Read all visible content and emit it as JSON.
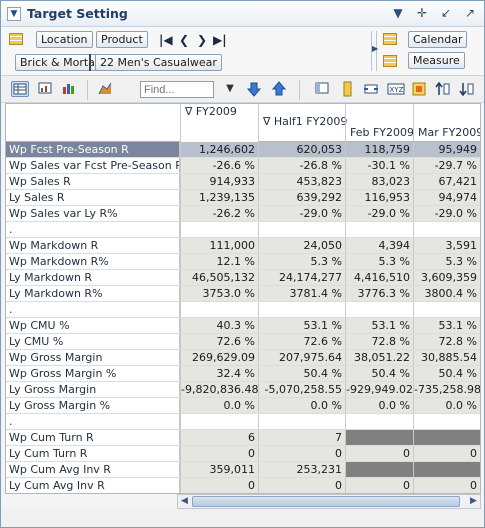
{
  "window": {
    "title": "Target Setting"
  },
  "title_icons": [
    "dropdown-arrow-icon",
    "move-icon",
    "minimize-icon",
    "expand-icon"
  ],
  "dimensions": {
    "location_label": "Location",
    "product_label": "Product",
    "calendar_label": "Calendar",
    "measure_label": "Measure",
    "location_value": "Brick & Mortar",
    "product_value": "22 Men's Casualwear"
  },
  "toolbar": {
    "find_placeholder": "Find..."
  },
  "columns": {
    "fy": "∇ FY2009",
    "half": "∇ Half1 FY2009",
    "feb": "Feb FY2009",
    "mar": "Mar FY2009"
  },
  "rows": [
    {
      "label": "Wp Fcst Pre-Season R",
      "v": [
        "1,246,602",
        "620,053",
        "118,759",
        "95,949"
      ],
      "selected": true
    },
    {
      "label": "Wp Sales var Fcst Pre-Season R%",
      "v": [
        "-26.6 %",
        "-26.8 %",
        "-30.1 %",
        "-29.7 %"
      ]
    },
    {
      "label": "Wp Sales R",
      "v": [
        "914,933",
        "453,823",
        "83,023",
        "67,421"
      ]
    },
    {
      "label": "Ly Sales R",
      "v": [
        "1,239,135",
        "639,292",
        "116,953",
        "94,974"
      ]
    },
    {
      "label": "Wp Sales var Ly R%",
      "v": [
        "-26.2 %",
        "-29.0 %",
        "-29.0 %",
        "-29.0 %"
      ]
    },
    {
      "label": ".",
      "v": [
        "",
        "",
        "",
        ""
      ],
      "blank": true
    },
    {
      "label": "Wp Markdown R",
      "v": [
        "111,000",
        "24,050",
        "4,394",
        "3,591"
      ]
    },
    {
      "label": "Wp Markdown R%",
      "v": [
        "12.1 %",
        "5.3 %",
        "5.3 %",
        "5.3 %"
      ]
    },
    {
      "label": "Ly Markdown R",
      "v": [
        "46,505,132",
        "24,174,277",
        "4,416,510",
        "3,609,359"
      ]
    },
    {
      "label": "Ly Markdown R%",
      "v": [
        "3753.0 %",
        "3781.4 %",
        "3776.3 %",
        "3800.4 %"
      ]
    },
    {
      "label": ".",
      "v": [
        "",
        "",
        "",
        ""
      ],
      "blank": true
    },
    {
      "label": "Wp CMU %",
      "v": [
        "40.3 %",
        "53.1 %",
        "53.1 %",
        "53.1 %"
      ]
    },
    {
      "label": "Ly CMU %",
      "v": [
        "72.6 %",
        "72.6 %",
        "72.8 %",
        "72.8 %"
      ]
    },
    {
      "label": "Wp Gross Margin",
      "v": [
        "269,629.09",
        "207,975.64",
        "38,051.22",
        "30,885.54"
      ]
    },
    {
      "label": "Wp Gross Margin %",
      "v": [
        "32.4 %",
        "50.4 %",
        "50.4 %",
        "50.4 %"
      ]
    },
    {
      "label": "Ly Gross Margin",
      "v": [
        "-9,820,836.48",
        "-5,070,258.55",
        "-929,949.02",
        "-735,258.98"
      ]
    },
    {
      "label": "Ly Gross Margin %",
      "v": [
        "0.0 %",
        "0.0 %",
        "0.0 %",
        "0.0 %"
      ]
    },
    {
      "label": ".",
      "v": [
        "",
        "",
        "",
        ""
      ],
      "blank": true
    },
    {
      "label": "Wp Cum Turn R",
      "v": [
        "6",
        "7",
        "",
        ""
      ],
      "dark": [
        2,
        3
      ]
    },
    {
      "label": "Ly Cum Turn R",
      "v": [
        "0",
        "0",
        "0",
        "0"
      ]
    },
    {
      "label": "Wp Cum Avg Inv R",
      "v": [
        "359,011",
        "253,231",
        "",
        ""
      ],
      "dark": [
        2,
        3
      ]
    },
    {
      "label": "Ly Cum Avg Inv R",
      "v": [
        "0",
        "0",
        "0",
        "0"
      ]
    }
  ]
}
